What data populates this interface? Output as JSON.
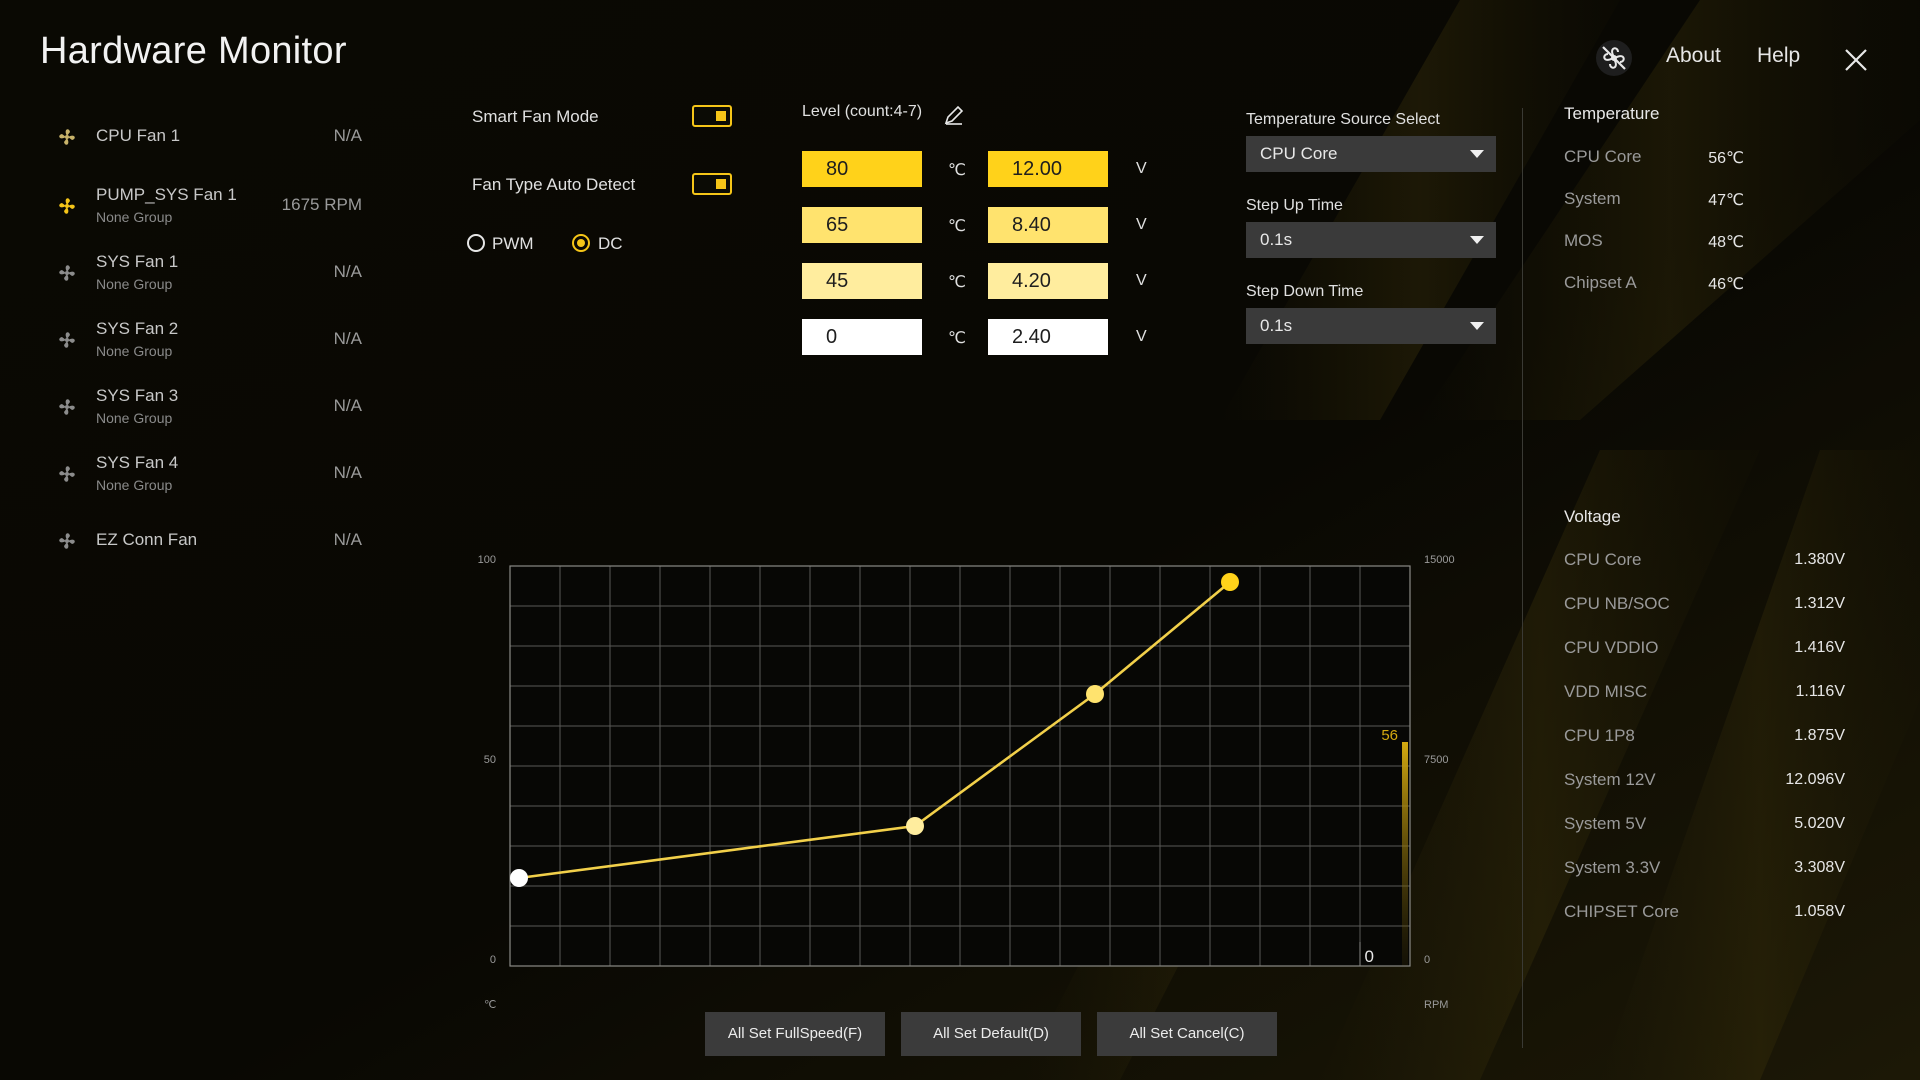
{
  "app": {
    "title": "Hardware Monitor"
  },
  "header": {
    "about_label": "About",
    "help_label": "Help"
  },
  "fans": [
    {
      "name": "CPU Fan 1",
      "group": "",
      "value": "N/A",
      "active": true
    },
    {
      "name": "PUMP_SYS Fan 1",
      "group": "None Group",
      "value": "1675 RPM",
      "active": false
    },
    {
      "name": "SYS Fan 1",
      "group": "None Group",
      "value": "N/A",
      "active": false
    },
    {
      "name": "SYS Fan 2",
      "group": "None Group",
      "value": "N/A",
      "active": false
    },
    {
      "name": "SYS Fan 3",
      "group": "None Group",
      "value": "N/A",
      "active": false
    },
    {
      "name": "SYS Fan 4",
      "group": "None Group",
      "value": "N/A",
      "active": false
    },
    {
      "name": "EZ Conn Fan",
      "group": "",
      "value": "N/A",
      "active": false
    }
  ],
  "settings": {
    "smart_fan_mode_label": "Smart Fan Mode",
    "smart_fan_mode_on": true,
    "fan_type_auto_detect_label": "Fan Type Auto Detect",
    "fan_type_auto_detect_on": true,
    "pwm_label": "PWM",
    "dc_label": "DC",
    "selected_type": "DC"
  },
  "level": {
    "label": "Level (count:4-7)",
    "temp_unit": "℃",
    "volt_unit": "V",
    "rows": [
      {
        "temp": "80",
        "volt": "12.00",
        "color": "#ffd21a"
      },
      {
        "temp": "65",
        "volt": "8.40",
        "color": "#ffe36e"
      },
      {
        "temp": "45",
        "volt": "4.20",
        "color": "#ffed9e"
      },
      {
        "temp": "0",
        "volt": "2.40",
        "color": "#ffffff"
      }
    ]
  },
  "temperature_source": {
    "label": "Temperature Source Select",
    "value": "CPU Core",
    "step_up_label": "Step Up Time",
    "step_up_value": "0.1s",
    "step_down_label": "Step Down Time",
    "step_down_value": "0.1s"
  },
  "temperature": {
    "title": "Temperature",
    "items": [
      {
        "label": "CPU Core",
        "value": "56℃"
      },
      {
        "label": "System",
        "value": "47℃"
      },
      {
        "label": "MOS",
        "value": "48℃"
      },
      {
        "label": "Chipset A",
        "value": "46℃"
      }
    ]
  },
  "voltage": {
    "title": "Voltage",
    "items": [
      {
        "label": "CPU Core",
        "value": "1.380V"
      },
      {
        "label": "CPU NB/SOC",
        "value": "1.312V"
      },
      {
        "label": "CPU VDDIO",
        "value": "1.416V"
      },
      {
        "label": "VDD MISC",
        "value": "1.116V"
      },
      {
        "label": "CPU 1P8",
        "value": "1.875V"
      },
      {
        "label": "System 12V",
        "value": "12.096V"
      },
      {
        "label": "System 5V",
        "value": "5.020V"
      },
      {
        "label": "System 3.3V",
        "value": "3.308V"
      },
      {
        "label": "CHIPSET Core",
        "value": "1.058V"
      }
    ]
  },
  "chart_data": {
    "type": "line",
    "xlim": [
      0,
      100
    ],
    "ylim": [
      0,
      100
    ],
    "rpm_lim": [
      0,
      15000
    ],
    "left_ticks": [
      "100",
      "50",
      "0"
    ],
    "right_ticks": [
      "15000",
      "7500",
      "0"
    ],
    "left_unit": "℃",
    "right_unit": "RPM",
    "points": [
      {
        "x": 1,
        "y": 22,
        "color": "#ffffff"
      },
      {
        "x": 45,
        "y": 35,
        "color": "#ffed9e"
      },
      {
        "x": 65,
        "y": 68,
        "color": "#ffe36e"
      },
      {
        "x": 80,
        "y": 96,
        "color": "#ffd21a"
      }
    ],
    "current_temp": "56",
    "current_temp_value": 56,
    "current_rpm": "0",
    "grid": true
  },
  "buttons": {
    "full_speed": "All Set FullSpeed(F)",
    "default": "All Set Default(D)",
    "cancel": "All Set Cancel(C)"
  }
}
